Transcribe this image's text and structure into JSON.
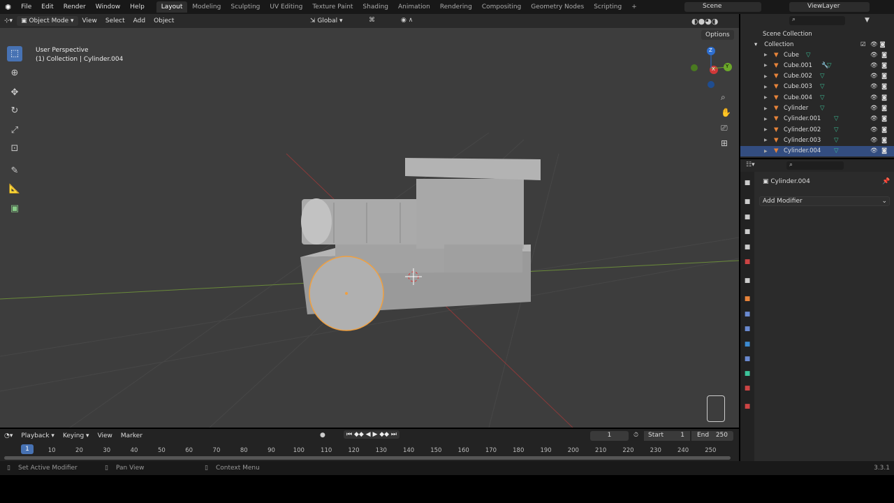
{
  "topbar": {
    "menus": [
      "File",
      "Edit",
      "Render",
      "Window",
      "Help"
    ],
    "workspaces": [
      "Layout",
      "Modeling",
      "Sculpting",
      "UV Editing",
      "Texture Paint",
      "Shading",
      "Animation",
      "Rendering",
      "Compositing",
      "Geometry Nodes",
      "Scripting"
    ],
    "active_workspace": "Layout",
    "scene": "Scene",
    "view_layer": "ViewLayer"
  },
  "viewport_header": {
    "mode": "Object Mode",
    "menus": [
      "View",
      "Select",
      "Add",
      "Object"
    ],
    "orientation": "Global",
    "options": "Options"
  },
  "viewport": {
    "perspective": "User Perspective",
    "collection_info": "(1) Collection | Cylinder.004",
    "gizmo": {
      "z": "Z",
      "y": "Y",
      "x": "X"
    },
    "selection_color": "#f0a040"
  },
  "outliner": {
    "root": "Scene Collection",
    "collection": "Collection",
    "items": [
      {
        "name": "Cube",
        "modifier": false
      },
      {
        "name": "Cube.001",
        "modifier": true
      },
      {
        "name": "Cube.002",
        "modifier": false
      },
      {
        "name": "Cube.003",
        "modifier": false
      },
      {
        "name": "Cube.004",
        "modifier": false
      },
      {
        "name": "Cylinder",
        "modifier": false
      },
      {
        "name": "Cylinder.001",
        "modifier": false
      },
      {
        "name": "Cylinder.002",
        "modifier": false
      },
      {
        "name": "Cylinder.003",
        "modifier": false
      },
      {
        "name": "Cylinder.004",
        "modifier": false
      }
    ],
    "selected": "Cylinder.004"
  },
  "properties": {
    "object_name": "Cylinder.004",
    "add_modifier": "Add Modifier"
  },
  "timeline": {
    "menus": [
      "Playback",
      "Keying",
      "View",
      "Marker"
    ],
    "current_frame": "1",
    "start_label": "Start",
    "start": "1",
    "end_label": "End",
    "end": "250",
    "ticks": [
      10,
      20,
      30,
      40,
      50,
      60,
      70,
      80,
      90,
      100,
      110,
      120,
      130,
      140,
      150,
      160,
      170,
      180,
      190,
      200,
      210,
      220,
      230,
      240,
      250
    ]
  },
  "status": {
    "left": "Set Active Modifier",
    "middle": "Pan View",
    "right": "Context Menu",
    "version": "3.3.1"
  }
}
